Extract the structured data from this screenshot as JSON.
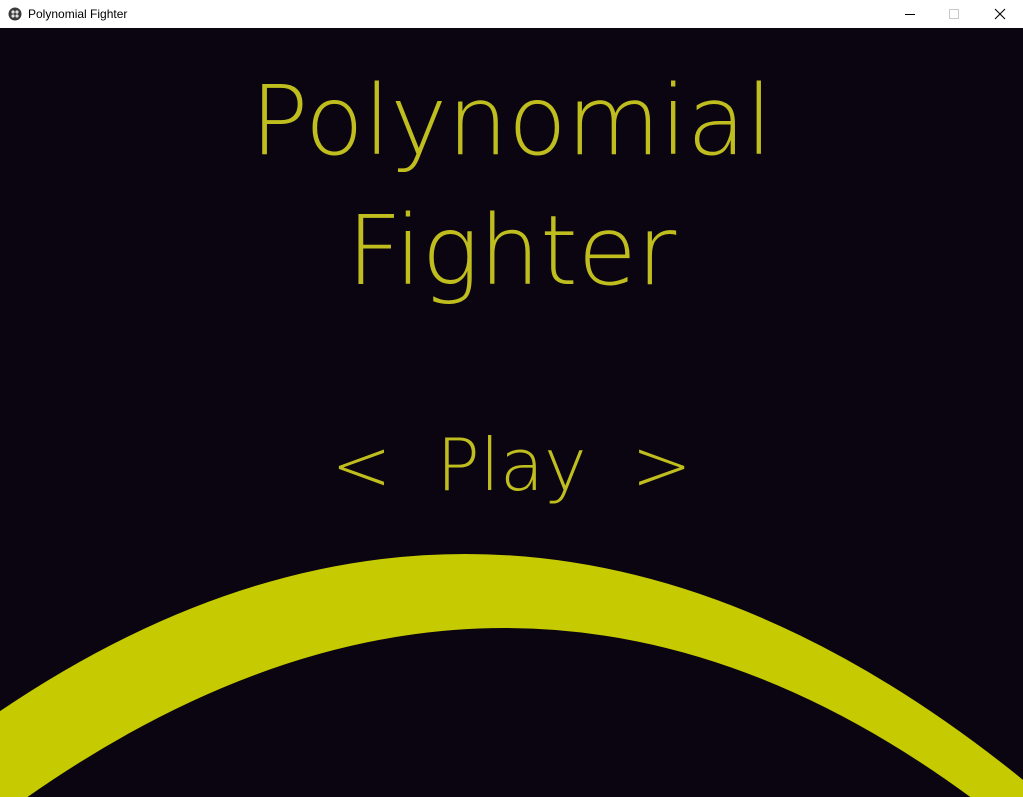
{
  "window": {
    "title": "Polynomial Fighter",
    "icon": "app-icon",
    "controls": [
      "minimize-icon",
      "maximize-icon",
      "close-icon"
    ]
  },
  "game": {
    "title_line1": "Polynomial",
    "title_line2": "Fighter",
    "menu": {
      "left_arrow": "<",
      "selected_item": "Play",
      "right_arrow": ">"
    }
  },
  "colors": {
    "background": "#0b0512",
    "text": "#bfbe1e",
    "arc": "#c5cb00",
    "titlebar": "#ffffff"
  }
}
